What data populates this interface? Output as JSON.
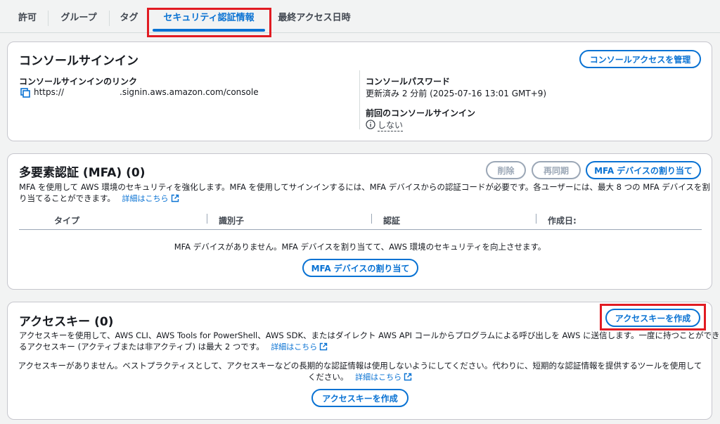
{
  "tabs": [
    {
      "label": "許可"
    },
    {
      "label": "グループ"
    },
    {
      "label": "タグ"
    },
    {
      "label": "セキュリティ認証情報"
    },
    {
      "label": "最終アクセス日時"
    }
  ],
  "console": {
    "title": "コンソールサインイン",
    "manage_button": "コンソールアクセスを管理",
    "link_label": "コンソールサインインのリンク",
    "link_prefix": "https://",
    "link_suffix": ".signin.aws.amazon.com/console",
    "password_label": "コンソールパスワード",
    "password_value": "更新済み 2 分前 (2025-07-16 13:01 GMT+9)",
    "last_signin_label": "前回のコンソールサインイン",
    "last_signin_value": "しない"
  },
  "mfa": {
    "title": "多要素認証 (MFA) (0)",
    "delete_button": "削除",
    "resync_button": "再同期",
    "assign_button": "MFA デバイスの割り当て",
    "desc_line1": "MFA を使用して AWS 環境のセキュリティを強化します。MFA を使用してサインインするには、MFA デバイスからの認証コードが必要です。各ユーザーには、最大 8 つの MFA デバイスを割",
    "desc_line2": "り当てることができます。",
    "learn_more": "詳細はこちら",
    "columns": [
      "タイプ",
      "識別子",
      "認証",
      "作成日:"
    ],
    "empty_text": "MFA デバイスがありません。MFA デバイスを割り当てて、AWS 環境のセキュリティを向上させます。",
    "empty_button": "MFA デバイスの割り当て"
  },
  "access_keys": {
    "title": "アクセスキー (0)",
    "create_button": "アクセスキーを作成",
    "desc_line1": "アクセスキーを使用して、AWS CLI、AWS Tools for PowerShell、AWS SDK、またはダイレクト AWS API コールからプログラムによる呼び出しを AWS に送信します。一度に持つことができ",
    "desc_line2": "るアクセスキー (アクティブまたは非アクティブ) は最大 2 つです。",
    "learn_more": "詳細はこちら",
    "empty_line1": "アクセスキーがありません。ベストプラクティスとして、アクセスキーなどの長期的な認証情報は使用しないようにしてください。代わりに、短期的な認証情報を提供するツールを使用して",
    "empty_line2": "ください。",
    "empty_learn_more": "詳細はこちら",
    "empty_button": "アクセスキーを作成"
  },
  "colors": {
    "accent": "#0972d3",
    "highlight": "#e11b22",
    "disabled": "#9ba7b6"
  }
}
